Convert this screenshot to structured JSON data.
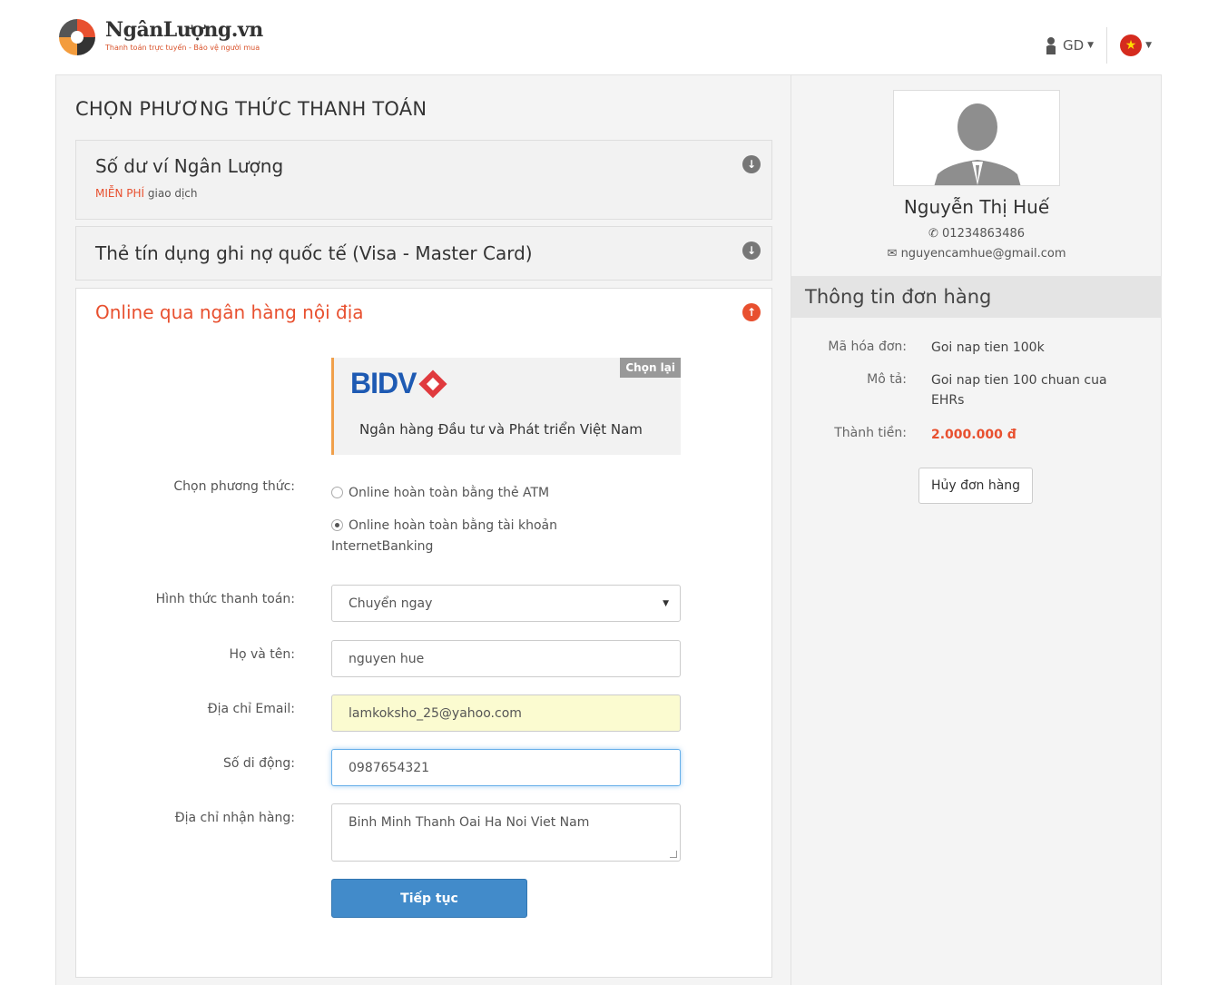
{
  "header": {
    "brand_name": "NgânLượng.vn",
    "brand_tagline": "Thanh toán trực tuyến - Bảo vệ người mua",
    "user_label": "GD",
    "language": "vi"
  },
  "main": {
    "title": "CHỌN PHƯƠNG THỨC THANH TOÁN",
    "sections": [
      {
        "title": "Số dư ví Ngân Lượng",
        "sub_free": "MIỄN PHÍ",
        "sub_rest": " giao dịch"
      },
      {
        "title": "Thẻ tín dụng ghi nợ quốc tế (Visa - Master Card)"
      },
      {
        "title": "Online qua ngân hàng nội địa"
      }
    ],
    "bank": {
      "logo_text": "BIDV",
      "name": "Ngân hàng Đầu tư và Phát triển Việt Nam",
      "reselect_label": "Chọn lại"
    },
    "form": {
      "method_label": "Chọn phương thức:",
      "method_options": [
        "Online hoàn toàn bằng thẻ ATM",
        "Online hoàn toàn bằng tài khoản InternetBanking"
      ],
      "payment_type_label": "Hình thức thanh toán:",
      "payment_type_value": "Chuyển ngay",
      "name_label": "Họ và tên:",
      "name_value": "nguyen hue",
      "email_label": "Địa chỉ Email:",
      "email_value": "lamkoksho_25@yahoo.com",
      "phone_label": "Số di động:",
      "phone_value": "0987654321",
      "address_label": "Địa chỉ nhận hàng:",
      "address_value": "Binh Minh Thanh Oai Ha Noi Viet Nam",
      "submit_label": "Tiếp tục"
    }
  },
  "side": {
    "user_name": "Nguyễn Thị Huế",
    "user_phone": "01234863486",
    "user_email": "nguyencamhue@gmail.com",
    "order_title": "Thông tin đơn hàng",
    "invoice_label": "Mã hóa đơn:",
    "invoice_value": "Goi nap tien 100k",
    "desc_label": "Mô tả:",
    "desc_value": "Goi nap tien 100 chuan cua EHRs",
    "amount_label": "Thành tiền:",
    "amount_value": "2.000.000 đ",
    "cancel_label": "Hủy đơn hàng"
  },
  "colors": {
    "accent": "#e8502f",
    "primary": "#428bca",
    "bank_blue": "#1e5ab3"
  }
}
